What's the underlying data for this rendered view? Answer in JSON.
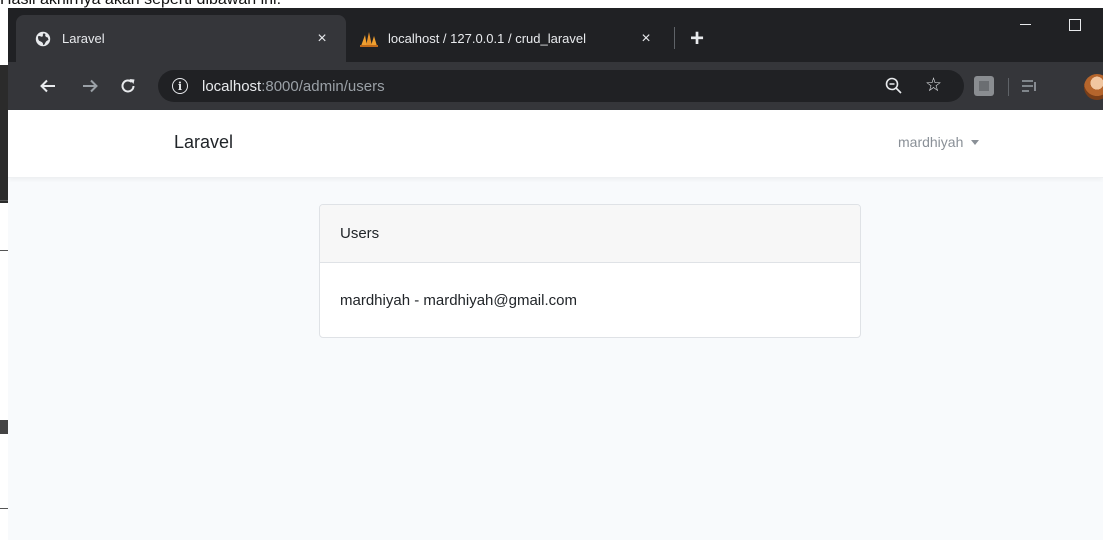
{
  "document": {
    "top_text": "Hasil akhirnya akan seperti dibawah ini:"
  },
  "browser": {
    "tabs": [
      {
        "title": "Laravel",
        "active": true,
        "icon": "globe-icon"
      },
      {
        "title": "localhost / 127.0.0.1 / crud_laravel",
        "active": false,
        "icon": "phpmyadmin-sail-icon"
      }
    ],
    "close_glyph": "×",
    "new_tab_glyph": "+",
    "address": {
      "host": "localhost",
      "path": ":8000/admin/users"
    }
  },
  "app": {
    "brand": "Laravel",
    "user_menu": "mardhiyah"
  },
  "card": {
    "header": "Users",
    "body": "mardhiyah - mardhiyah@gmail.com"
  },
  "colors": {
    "tabstrip": "#202124",
    "toolbar": "#35363a",
    "page_bg": "#f8fafc",
    "card_header_bg": "#f7f7f7"
  }
}
